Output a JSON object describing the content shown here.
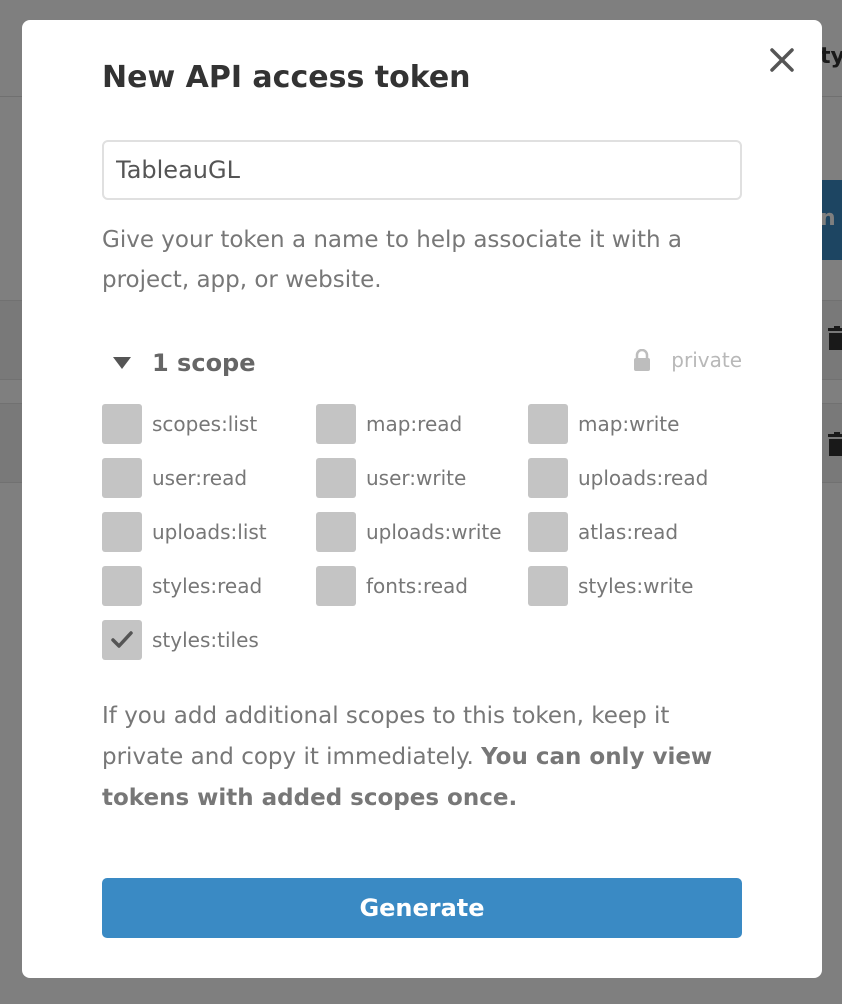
{
  "background": {
    "column_heading_fragment": "ty",
    "button_fragment": "n"
  },
  "modal": {
    "title": "New API access token",
    "close_icon": "close-icon",
    "token_name": {
      "value": "TableauGL",
      "placeholder": ""
    },
    "help_text": "Give your token a name to help associate it with a project, app, or website.",
    "scopes": {
      "toggle_icon": "caret-down-icon",
      "count_label": "1 scope",
      "privacy_icon": "lock-icon",
      "privacy_label": "private",
      "items": [
        {
          "label": "scopes:list",
          "checked": false
        },
        {
          "label": "map:read",
          "checked": false
        },
        {
          "label": "map:write",
          "checked": false
        },
        {
          "label": "user:read",
          "checked": false
        },
        {
          "label": "user:write",
          "checked": false
        },
        {
          "label": "uploads:read",
          "checked": false
        },
        {
          "label": "uploads:list",
          "checked": false
        },
        {
          "label": "uploads:write",
          "checked": false
        },
        {
          "label": "atlas:read",
          "checked": false
        },
        {
          "label": "styles:read",
          "checked": false
        },
        {
          "label": "fonts:read",
          "checked": false
        },
        {
          "label": "styles:write",
          "checked": false
        },
        {
          "label": "styles:tiles",
          "checked": true
        }
      ]
    },
    "warning": {
      "text": "If you add additional scopes to this token, keep it private and copy it immediately.",
      "bold_text": "You can only view tokens with added scopes once."
    },
    "generate_label": "Generate"
  },
  "colors": {
    "primary_button": "#3a8ac4",
    "checkbox_fill": "#c4c4c4",
    "checkmark": "#555555",
    "overlay": "rgba(0,0,0,0.5)"
  }
}
